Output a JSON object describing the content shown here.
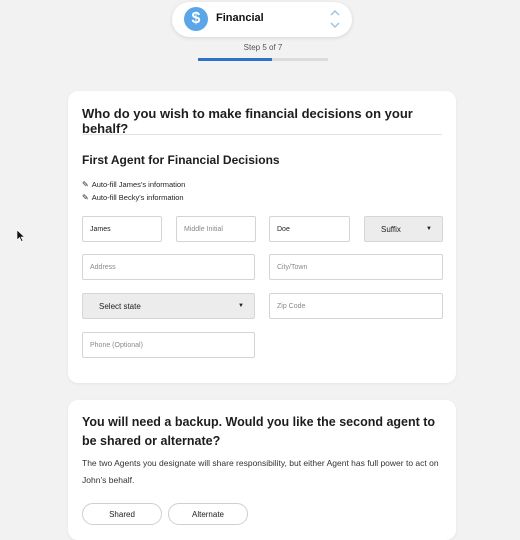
{
  "header": {
    "section_icon": "dollar-icon",
    "section_glyph": "$",
    "section_label": "Financial",
    "step_text": "Step 5 of 7",
    "progress_fraction": 0.57
  },
  "card1": {
    "question": "Who do you wish to make financial decisions on your behalf?",
    "section_title": "First Agent for Financial Decisions",
    "autofill": [
      "Auto-fill James's information",
      "Auto-fill Becky's information"
    ],
    "form": {
      "first_name_value": "James",
      "middle_initial_placeholder": "Middle Initial",
      "last_name_value": "Doe",
      "suffix_label": "Suffix",
      "address_placeholder": "Address",
      "city_placeholder": "City/Town",
      "state_label": "Select state",
      "zip_placeholder": "Zip Code",
      "phone_placeholder": "Phone (Optional)"
    }
  },
  "card2": {
    "question": "You will need a backup. Would you like the second agent to be shared or alternate?",
    "description": "The two Agents you designate will share responsibility, but either Agent has full power to act on John’s behalf.",
    "options": [
      "Shared",
      "Alternate"
    ]
  },
  "colors": {
    "accent": "#2e73c7",
    "icon_bg": "#5aa6e8",
    "background": "#f2f2f2"
  }
}
